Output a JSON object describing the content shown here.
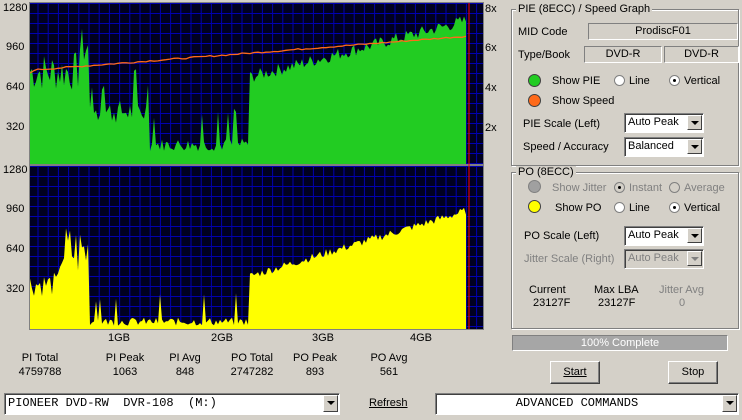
{
  "graph_top": {
    "y_ticks": [
      "1280",
      "960",
      "640",
      "320"
    ],
    "speed_ticks": [
      "8x",
      "6x",
      "4x",
      "2x"
    ]
  },
  "graph_bottom": {
    "y_ticks": [
      "1280",
      "960",
      "640",
      "320"
    ]
  },
  "x_ticks": [
    "1GB",
    "2GB",
    "3GB",
    "4GB"
  ],
  "stats": [
    {
      "label": "PI Total",
      "value": "4759788"
    },
    {
      "label": "PI Peak",
      "value": "1063"
    },
    {
      "label": "PI Avg",
      "value": "848"
    },
    {
      "label": "PO Total",
      "value": "2747282"
    },
    {
      "label": "PO Peak",
      "value": "893"
    },
    {
      "label": "PO Avg",
      "value": "561"
    }
  ],
  "pie_panel": {
    "title": "PIE (8ECC) / Speed Graph",
    "mid_label": "MID Code",
    "mid_value": "ProdiscF01",
    "type_label": "Type/Book",
    "type_value": "DVD-R",
    "book_value": "DVD-R",
    "show_pie": "Show PIE",
    "show_speed": "Show Speed",
    "line": "Line",
    "vertical": "Vertical",
    "scale_label": "PIE Scale (Left)",
    "scale_value": "Auto Peak",
    "speed_label": "Speed / Accuracy",
    "speed_value": "Balanced",
    "pie_color": "#22cc22",
    "speed_color": "#ff6a1a"
  },
  "po_panel": {
    "title": "PO (8ECC)",
    "show_jitter": "Show Jitter",
    "instant": "Instant",
    "average": "Average",
    "show_po": "Show PO",
    "line": "Line",
    "vertical": "Vertical",
    "scale_label": "PO Scale (Left)",
    "scale_value": "Auto Peak",
    "jitter_label": "Jitter Scale (Right)",
    "jitter_value": "Auto Peak",
    "current_label": "Current",
    "current_value": "23127F",
    "maxlba_label": "Max LBA",
    "maxlba_value": "23127F",
    "jitter_avg_label": "Jitter Avg",
    "jitter_avg_value": "0",
    "po_color": "#ffff00"
  },
  "progress": {
    "text": "100% Complete",
    "fraction": 1.0
  },
  "buttons": {
    "start": "Start",
    "stop": "Stop",
    "refresh": "Refresh"
  },
  "drive": "PIONEER DVD-RW  DVR-108  (M:)",
  "advanced": "ADVANCED COMMANDS"
}
